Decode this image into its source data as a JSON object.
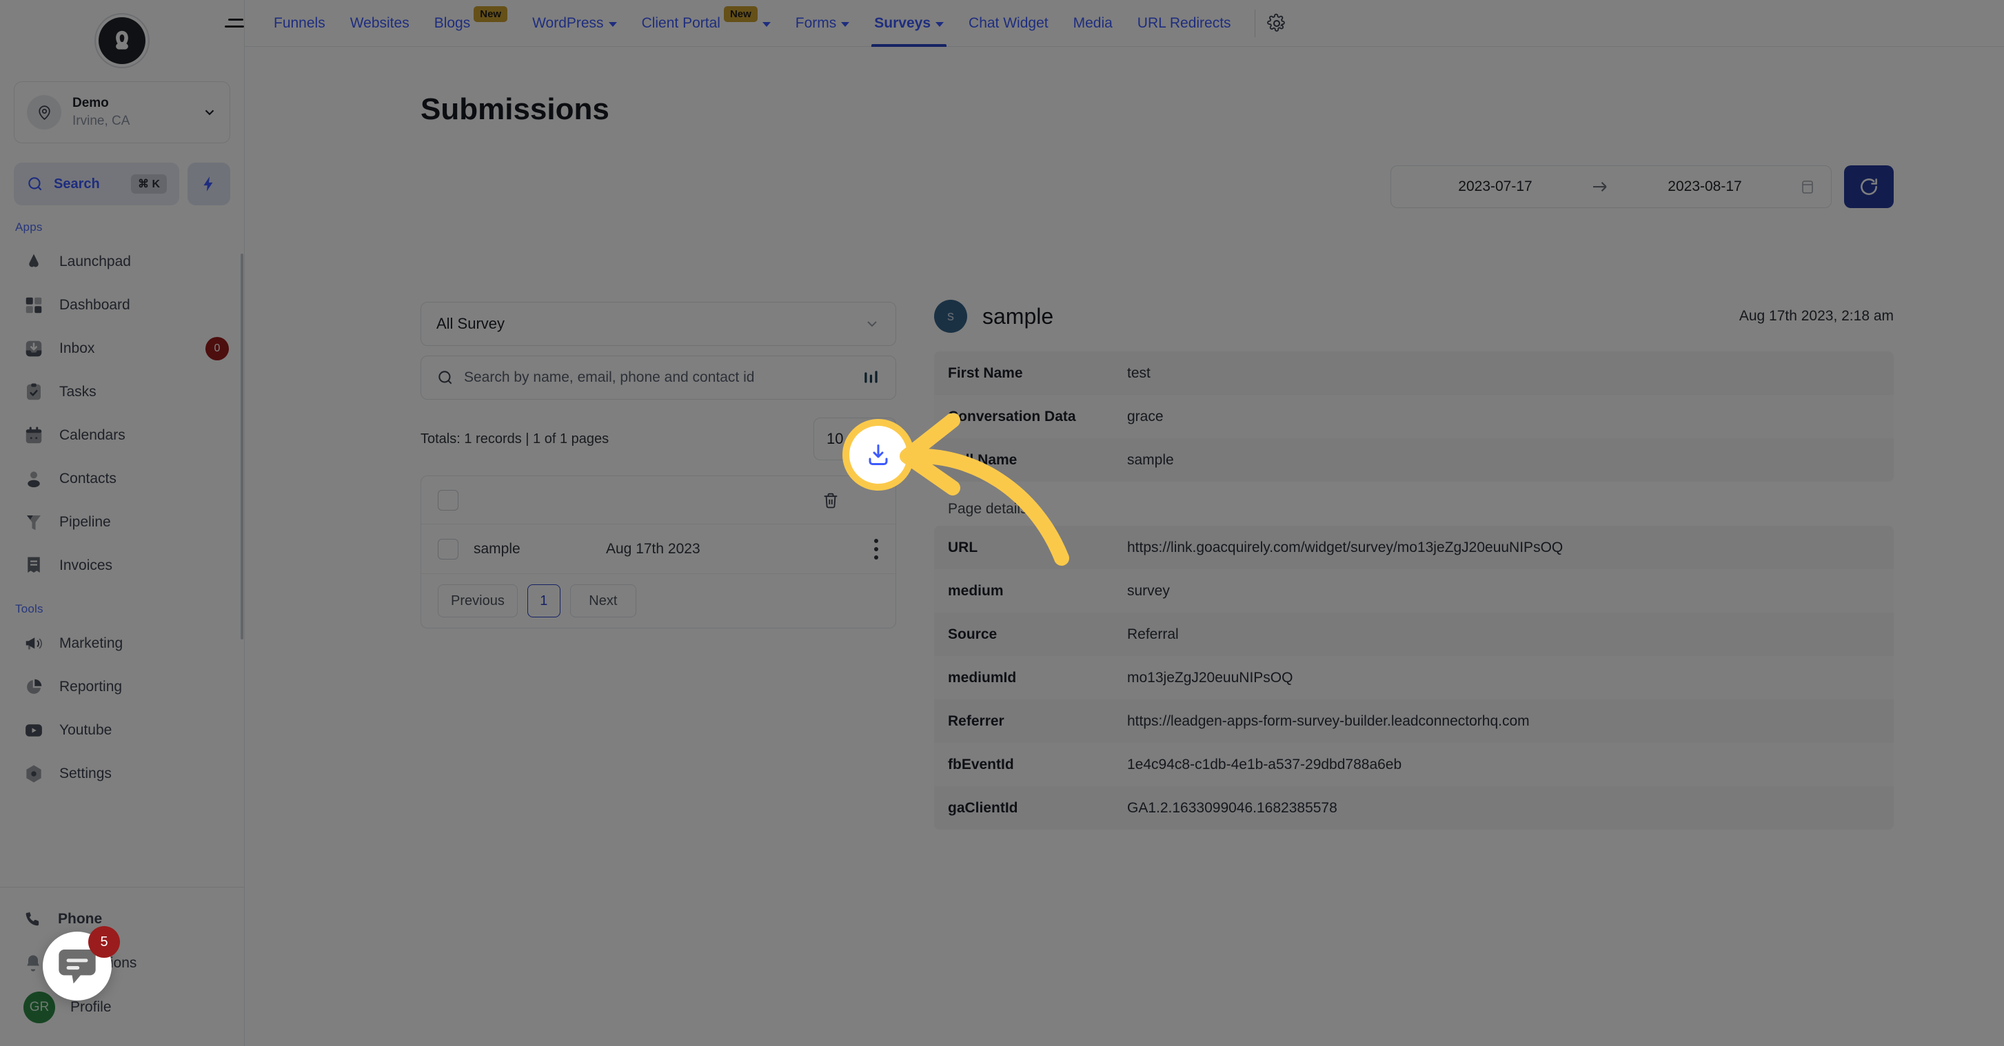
{
  "sidebar": {
    "logo_icon": "brand-a-logo",
    "location": {
      "name": "Demo",
      "sub": "Irvine, CA"
    },
    "search": {
      "label": "Search",
      "shortcut": "⌘ K"
    },
    "section_apps": "Apps",
    "section_tools": "Tools",
    "apps": [
      {
        "label": "Launchpad",
        "icon": "launchpad-icon"
      },
      {
        "label": "Dashboard",
        "icon": "dashboard-icon"
      },
      {
        "label": "Inbox",
        "icon": "inbox-icon",
        "badge": "0"
      },
      {
        "label": "Tasks",
        "icon": "tasks-icon"
      },
      {
        "label": "Calendars",
        "icon": "calendar-icon"
      },
      {
        "label": "Contacts",
        "icon": "contacts-icon"
      },
      {
        "label": "Pipeline",
        "icon": "pipeline-icon"
      },
      {
        "label": "Invoices",
        "icon": "invoices-icon"
      }
    ],
    "tools": [
      {
        "label": "Marketing",
        "icon": "megaphone-icon"
      },
      {
        "label": "Reporting",
        "icon": "pie-chart-icon"
      },
      {
        "label": "Youtube",
        "icon": "youtube-icon"
      },
      {
        "label": "Settings",
        "icon": "settings-icon"
      }
    ],
    "footer": [
      {
        "label": "Phone",
        "icon": "phone-icon"
      },
      {
        "label": "Notifications",
        "icon": "bell-icon"
      },
      {
        "label": "Profile",
        "icon": "avatar",
        "initials": "GR"
      }
    ]
  },
  "topnav": {
    "tabs": [
      {
        "label": "Funnels",
        "caret": false,
        "badge": "",
        "active": false
      },
      {
        "label": "Websites",
        "caret": false,
        "badge": "",
        "active": false
      },
      {
        "label": "Blogs",
        "caret": false,
        "badge": "New",
        "active": false
      },
      {
        "label": "WordPress",
        "caret": true,
        "badge": "",
        "active": false
      },
      {
        "label": "Client Portal",
        "caret": true,
        "badge": "New",
        "active": false
      },
      {
        "label": "Forms",
        "caret": true,
        "badge": "",
        "active": false
      },
      {
        "label": "Surveys",
        "caret": true,
        "badge": "",
        "active": true
      },
      {
        "label": "Chat Widget",
        "caret": false,
        "badge": "",
        "active": false
      },
      {
        "label": "Media",
        "caret": false,
        "badge": "",
        "active": false
      },
      {
        "label": "URL Redirects",
        "caret": false,
        "badge": "",
        "active": false
      }
    ],
    "settings_icon": "gear-icon"
  },
  "page": {
    "title": "Submissions",
    "date_range": {
      "start": "2023-07-17",
      "end": "2023-08-17",
      "calendar_icon": "calendar-icon"
    },
    "refresh_icon": "refresh-icon"
  },
  "filters": {
    "survey_select": "All Survey",
    "search_placeholder": "Search by name, email, phone and contact id",
    "filter_icon": "filter-sliders-icon",
    "totals_text": "Totals: 1 records | 1 of 1 pages",
    "totals_count": "1",
    "page_size": "10"
  },
  "list": {
    "delete_icon": "trash-icon",
    "download_icon": "download-icon",
    "rows": [
      {
        "name": "sample",
        "date": "Aug 17th 2023"
      }
    ],
    "pagination": {
      "previous": "Previous",
      "current": "1",
      "next": "Next"
    }
  },
  "detail": {
    "avatar_initial": "s",
    "title": "sample",
    "timestamp": "Aug 17th 2023, 2:18 am",
    "fields": [
      {
        "key": "First Name",
        "value": "test"
      },
      {
        "key": "Conversation Data",
        "value": "grace"
      },
      {
        "key": "Full Name",
        "value": "sample"
      }
    ],
    "page_details_label": "Page details",
    "page_details": [
      {
        "key": "URL",
        "value": "https://link.goacquirely.com/widget/survey/mo13jeZgJ20euuNIPsOQ"
      },
      {
        "key": "medium",
        "value": "survey"
      },
      {
        "key": "Source",
        "value": "Referral"
      },
      {
        "key": "mediumId",
        "value": "mo13jeZgJ20euuNIPsOQ"
      },
      {
        "key": "Referrer",
        "value": "https://leadgen-apps-form-survey-builder.leadconnectorhq.com"
      },
      {
        "key": "fbEventId",
        "value": "1e4c94c8-c1db-4e1b-a537-29dbd788a6eb"
      },
      {
        "key": "gaClientId",
        "value": "GA1.2.1633099046.1682385578"
      }
    ]
  },
  "chat_widget": {
    "icon": "chat-bubble-icon",
    "badge": "5"
  },
  "annotation": {
    "highlight_target": "download-button",
    "highlight_color": "#fbc94a",
    "arrow_color": "#fbc94a"
  },
  "colors": {
    "accent_blue": "#3d5afe",
    "primary_blue": "#253a9c",
    "badge_new": "#caa031",
    "badge_red": "#9b1c1c",
    "highlight_yellow": "#fbc94a"
  }
}
